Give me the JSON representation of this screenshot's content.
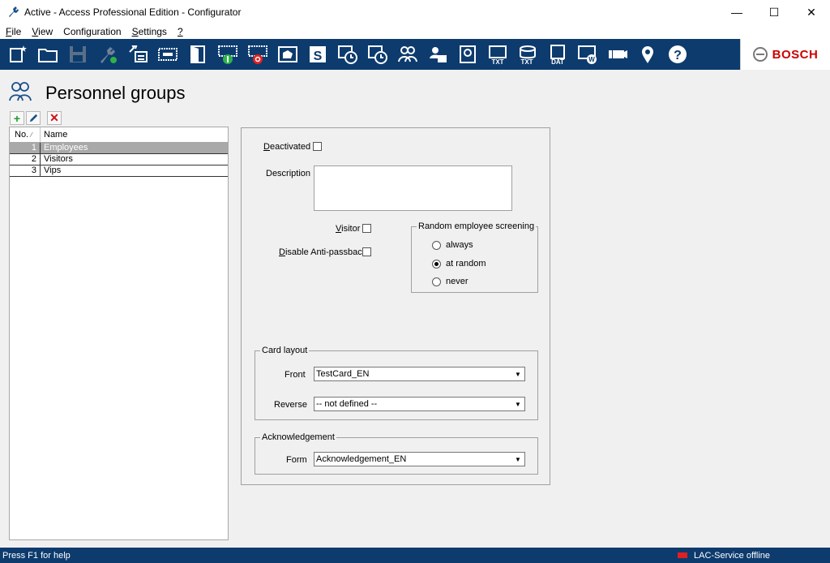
{
  "window": {
    "title": "Active - Access Professional Edition - Configurator",
    "minimize": "—",
    "maximize": "☐",
    "close": "✕"
  },
  "menu": {
    "items": [
      {
        "accel": "F",
        "rest": "ile"
      },
      {
        "accel": "V",
        "rest": "iew"
      },
      {
        "accel": "",
        "rest": "Configuration"
      },
      {
        "accel": "S",
        "rest": "ettings"
      },
      {
        "accel": "?",
        "rest": ""
      }
    ]
  },
  "toolbar": {
    "icons": [
      "new-icon",
      "open-folder-icon",
      "save-icon",
      "tools-icon",
      "network-icon",
      "card-reader-icon",
      "door-icon",
      "entrance-icon",
      "exit-icon",
      "area-icon",
      "special-day-icon",
      "time-model-icon",
      "time-plan-icon",
      "personnel-groups-icon",
      "access-profile-icon",
      "card-layout-icon",
      "text-file-icon",
      "database-text-icon",
      "data-icon",
      "workstation-icon",
      "camera-icon",
      "location-pin-icon",
      "help-icon"
    ],
    "brand": "BOSCH"
  },
  "page": {
    "title": "Personnel groups"
  },
  "list": {
    "col_no": "No.",
    "col_name": "Name",
    "rows": [
      {
        "no": "1",
        "name": "Employees"
      },
      {
        "no": "2",
        "name": "Visitors"
      },
      {
        "no": "3",
        "name": "Vips"
      }
    ]
  },
  "form": {
    "deactivated_accel": "D",
    "deactivated_rest": "eactivated",
    "description": "Description",
    "visitor_accel": "V",
    "visitor_rest": "isitor",
    "antipassback_accel": "D",
    "antipassback_rest": "isable Anti-passback",
    "screening": {
      "title": "Random employee screening",
      "options": [
        "always",
        "at random",
        "never"
      ],
      "selected": "at random"
    },
    "card_layout": {
      "title": "Card layout",
      "front_label": "Front",
      "front_value": "TestCard_EN",
      "reverse_label": "Reverse",
      "reverse_value": "-- not defined --"
    },
    "acknowledgement": {
      "title": "Acknowledgement",
      "form_label": "Form",
      "form_value": "Acknowledgement_EN"
    }
  },
  "status": {
    "help": "Press F1 for help",
    "service": "LAC-Service offline"
  },
  "colors": {
    "toolbar_bg": "#0d3b6e",
    "brand_red": "#cc0000",
    "selected_row": "#a9a9a9"
  }
}
